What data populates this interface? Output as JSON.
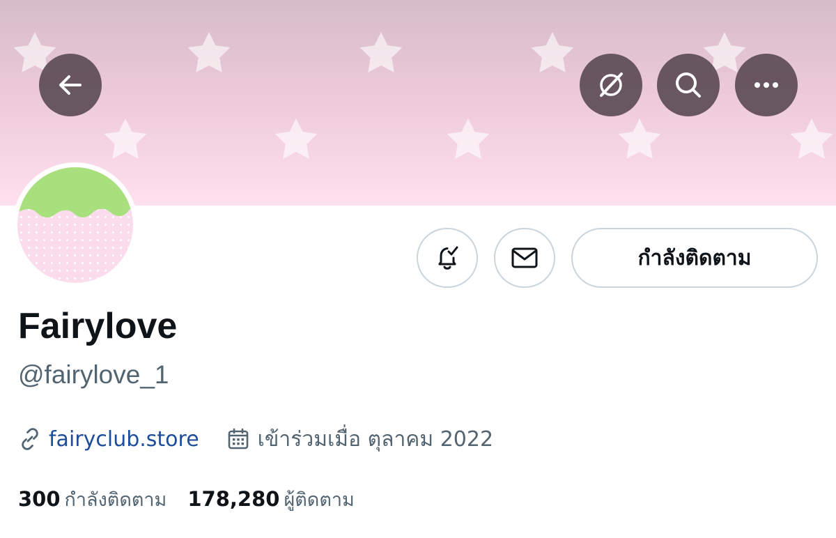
{
  "header": {
    "back_icon": "arrow-left-icon",
    "actions": [
      {
        "icon": "grok-icon"
      },
      {
        "icon": "search-icon"
      },
      {
        "icon": "more-horizontal-icon"
      }
    ],
    "banner_colors": [
      "#d5bcc8",
      "#ffe0ee"
    ]
  },
  "profile": {
    "display_name": "Fairylove",
    "handle": "@fairylove_1",
    "website": "fairyclub.store",
    "joined": "เข้าร่วมเมื่อ ตุลาคม 2022",
    "following_count": "300",
    "following_label": "กำลังติดตาม",
    "followers_count": "178,280",
    "followers_label": "ผู้ติดตาม"
  },
  "buttons": {
    "notify_icon": "bell-check-icon",
    "message_icon": "envelope-icon",
    "follow_label": "กำลังติดตาม"
  },
  "colors": {
    "link": "#1d4d9c",
    "secondary_text": "#536471",
    "primary_text": "#0f1419",
    "button_border": "#c9d4dc",
    "avatar_green": "#a8e07e",
    "avatar_pink": "#fbdcec"
  }
}
